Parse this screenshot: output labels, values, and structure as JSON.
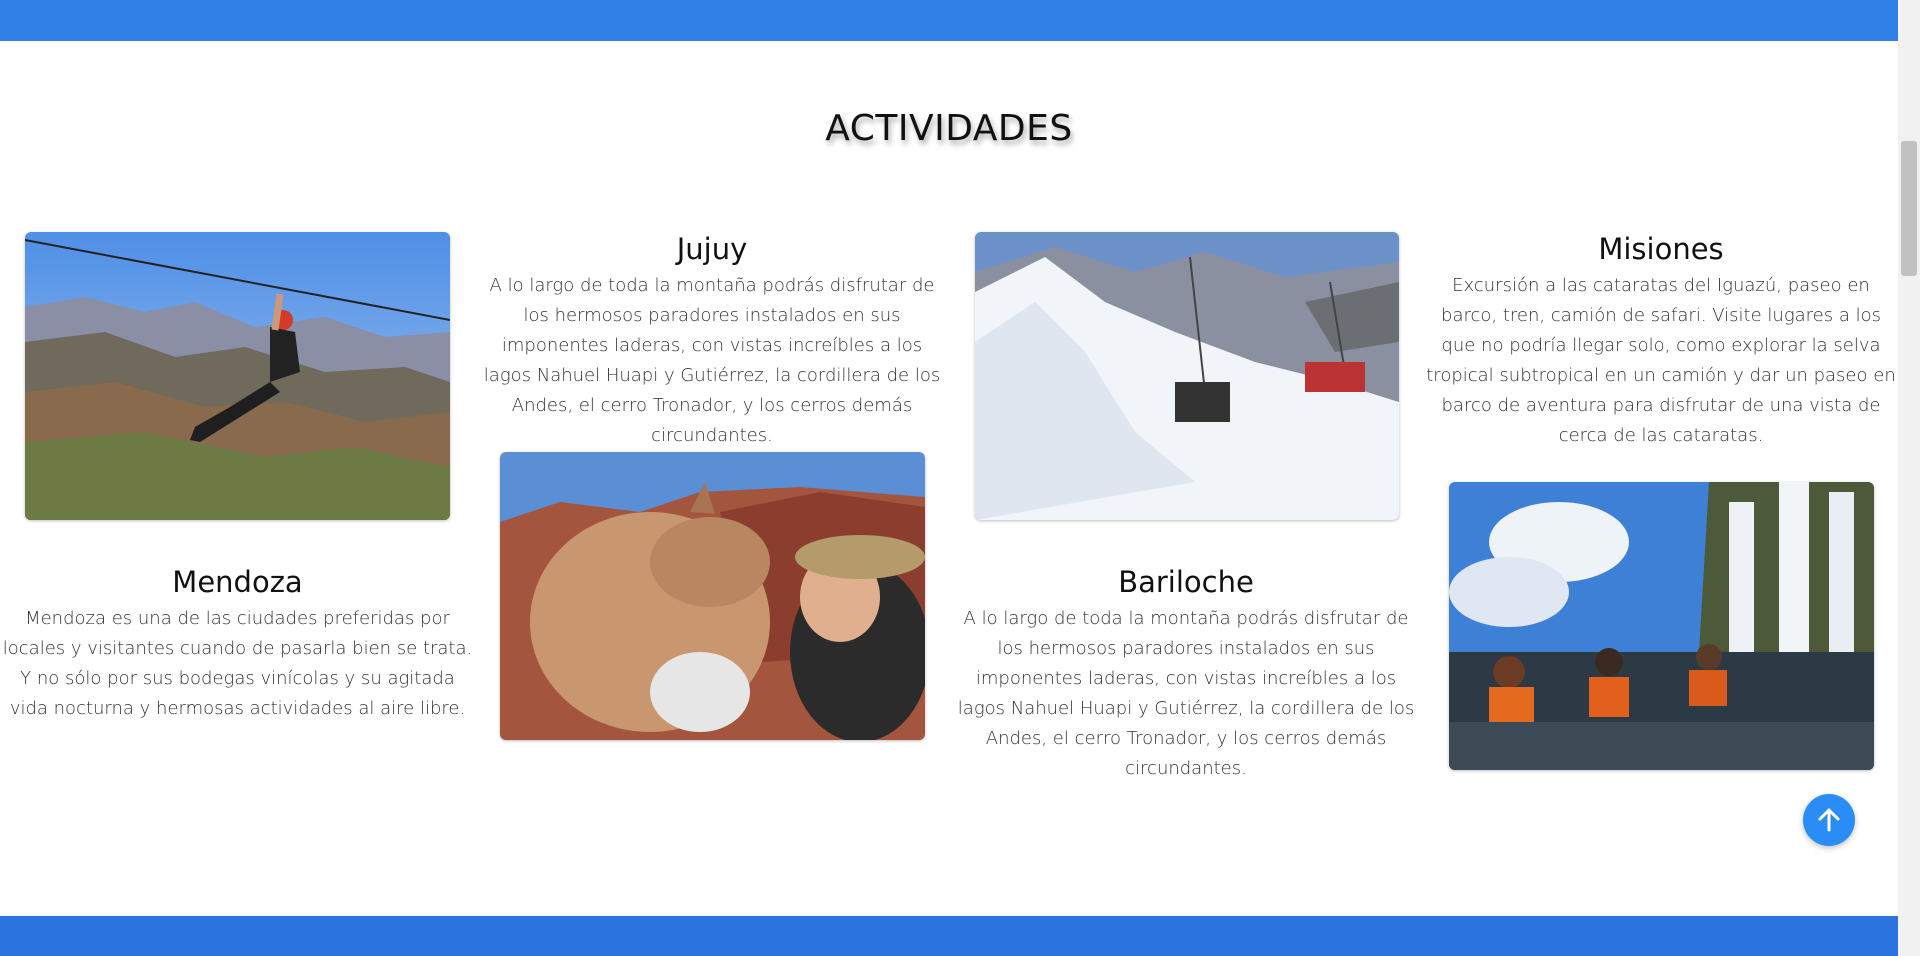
{
  "section": {
    "title": "ACTIVIDADES"
  },
  "cards": {
    "jujuy": {
      "title": "Jujuy",
      "description": "A lo largo de toda la montaña podrás disfrutar de los hermosos paradores instalados en sus imponentes laderas, con vistas increíbles a los lagos Nahuel Huapi y Gutiérrez, la cordillera de los Andes, el cerro Tronador, y los cerros demás circundantes."
    },
    "misiones": {
      "title": "Misiones",
      "description": "Excursión a las cataratas del Iguazú, paseo en barco, tren, camión de safari. Visite lugares a los que no podría llegar solo, como explorar la selva tropical subtropical en un camión y dar un paseo en barco de aventura para disfrutar de una vista de cerca de las cataratas."
    },
    "mendoza": {
      "title": "Mendoza",
      "description": "Mendoza es una de las ciudades preferidas por locales y visitantes cuando de pasarla bien se trata. Y no sólo por sus bodegas vinícolas y su agitada vida nocturna y hermosas actividades al aire libre."
    },
    "bariloche": {
      "title": "Bariloche",
      "description": "A lo largo de toda la montaña podrás disfrutar de los hermosos paradores instalados en sus imponentes laderas, con vistas increíbles a los lagos Nahuel Huapi y Gutiérrez, la cordillera de los Andes, el cerro Tronador, y los cerros demás circundantes."
    }
  },
  "scroll_top": {
    "icon": "arrow-up-icon"
  },
  "colors": {
    "header_bar": "#2f7fe5",
    "footer_bar": "#2b73de",
    "scroll_top_button": "#2a8df5"
  }
}
